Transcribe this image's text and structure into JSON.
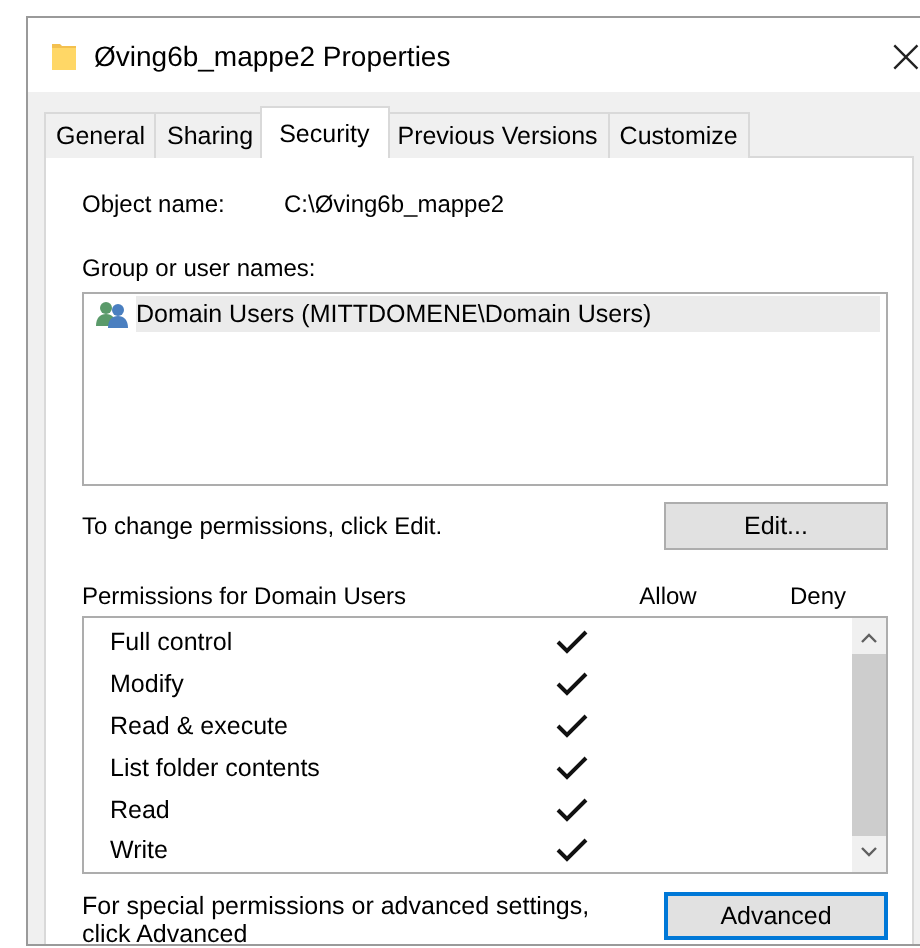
{
  "window": {
    "title": "Øving6b_mappe2 Properties",
    "close": "×"
  },
  "tabs": [
    {
      "label": "General",
      "selected": false
    },
    {
      "label": "Sharing",
      "selected": false
    },
    {
      "label": "Security",
      "selected": true
    },
    {
      "label": "Previous Versions",
      "selected": false
    },
    {
      "label": "Customize",
      "selected": false
    }
  ],
  "object_name": {
    "label": "Object name:",
    "value": "C:\\Øving6b_mappe2"
  },
  "groups": {
    "label": "Group or user names:",
    "items": [
      {
        "name": "Domain Users (MITTDOMENE\\Domain Users)",
        "selected": true
      }
    ]
  },
  "edit_hint": "To change permissions, click Edit.",
  "edit_button": "Edit...",
  "permissions": {
    "label": "Permissions for Domain Users",
    "columns": [
      "Allow",
      "Deny"
    ],
    "rows": [
      {
        "name": "Full control",
        "allow": true,
        "deny": false
      },
      {
        "name": "Modify",
        "allow": true,
        "deny": false
      },
      {
        "name": "Read & execute",
        "allow": true,
        "deny": false
      },
      {
        "name": "List folder contents",
        "allow": true,
        "deny": false
      },
      {
        "name": "Read",
        "allow": true,
        "deny": false
      },
      {
        "name": "Write",
        "allow": true,
        "deny": false
      }
    ]
  },
  "advanced_hint": "For special permissions or advanced settings, click Advanced",
  "advanced_button": "Advanced"
}
